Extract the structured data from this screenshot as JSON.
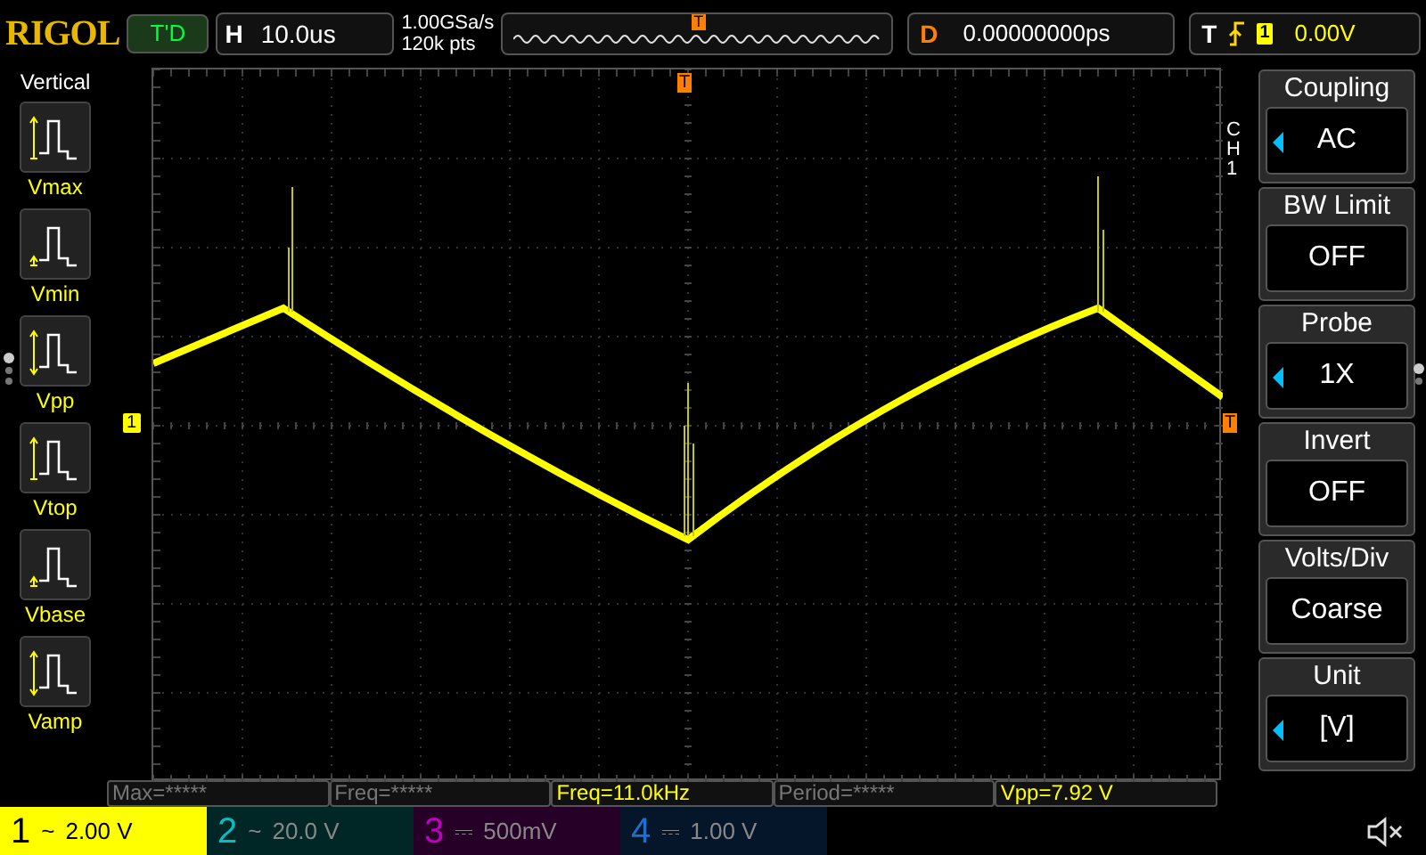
{
  "top_bar": {
    "logo": "RIGOL",
    "run_status": "T'D",
    "horizontal": {
      "label": "H",
      "timebase": "10.0us"
    },
    "sample_rate": "1.00GSa/s",
    "memory_depth": "120k pts",
    "trigger_marker": "T",
    "delay": {
      "label": "D",
      "value": "0.00000000ps"
    },
    "trigger": {
      "label": "T",
      "source": "1",
      "level": "0.00V"
    }
  },
  "left_panel": {
    "title": "Vertical",
    "items": [
      {
        "label": "Vmax",
        "kind": "top"
      },
      {
        "label": "Vmin",
        "kind": "base"
      },
      {
        "label": "Vpp",
        "kind": "span"
      },
      {
        "label": "Vtop",
        "kind": "top"
      },
      {
        "label": "Vbase",
        "kind": "base"
      },
      {
        "label": "Vamp",
        "kind": "span"
      }
    ]
  },
  "grid": {
    "trigger_marker": "T",
    "channel_marker": "1",
    "level_marker": "T"
  },
  "menu": {
    "channel": "CH1",
    "items": [
      {
        "title": "Coupling",
        "value": "AC",
        "adjustable": true
      },
      {
        "title": "BW Limit",
        "value": "OFF",
        "adjustable": false
      },
      {
        "title": "Probe",
        "value": "1X",
        "adjustable": true
      },
      {
        "title": "Invert",
        "value": "OFF",
        "adjustable": false
      },
      {
        "title": "Volts/Div",
        "value": "Coarse",
        "adjustable": false
      },
      {
        "title": "Unit",
        "value": "[V]",
        "adjustable": true
      }
    ]
  },
  "measurements": [
    {
      "text": "Max=*****",
      "active": false
    },
    {
      "text": "Freq=*****",
      "active": false
    },
    {
      "text": "Freq=11.0kHz",
      "active": true
    },
    {
      "text": "Period=*****",
      "active": false
    },
    {
      "text": "Vpp=7.92 V",
      "active": true
    }
  ],
  "channels": [
    {
      "number": "1",
      "coupling": "~",
      "scale": "2.00 V",
      "selected": true,
      "color": "#ffff00"
    },
    {
      "number": "2",
      "coupling": "~",
      "scale": "20.0 V",
      "selected": false,
      "color": "#00c0c0"
    },
    {
      "number": "3",
      "coupling": "⎓",
      "scale": "500mV",
      "selected": false,
      "color": "#c000c0"
    },
    {
      "number": "4",
      "coupling": "⎓",
      "scale": "1.00 V",
      "selected": false,
      "color": "#1e6fd0"
    }
  ]
}
